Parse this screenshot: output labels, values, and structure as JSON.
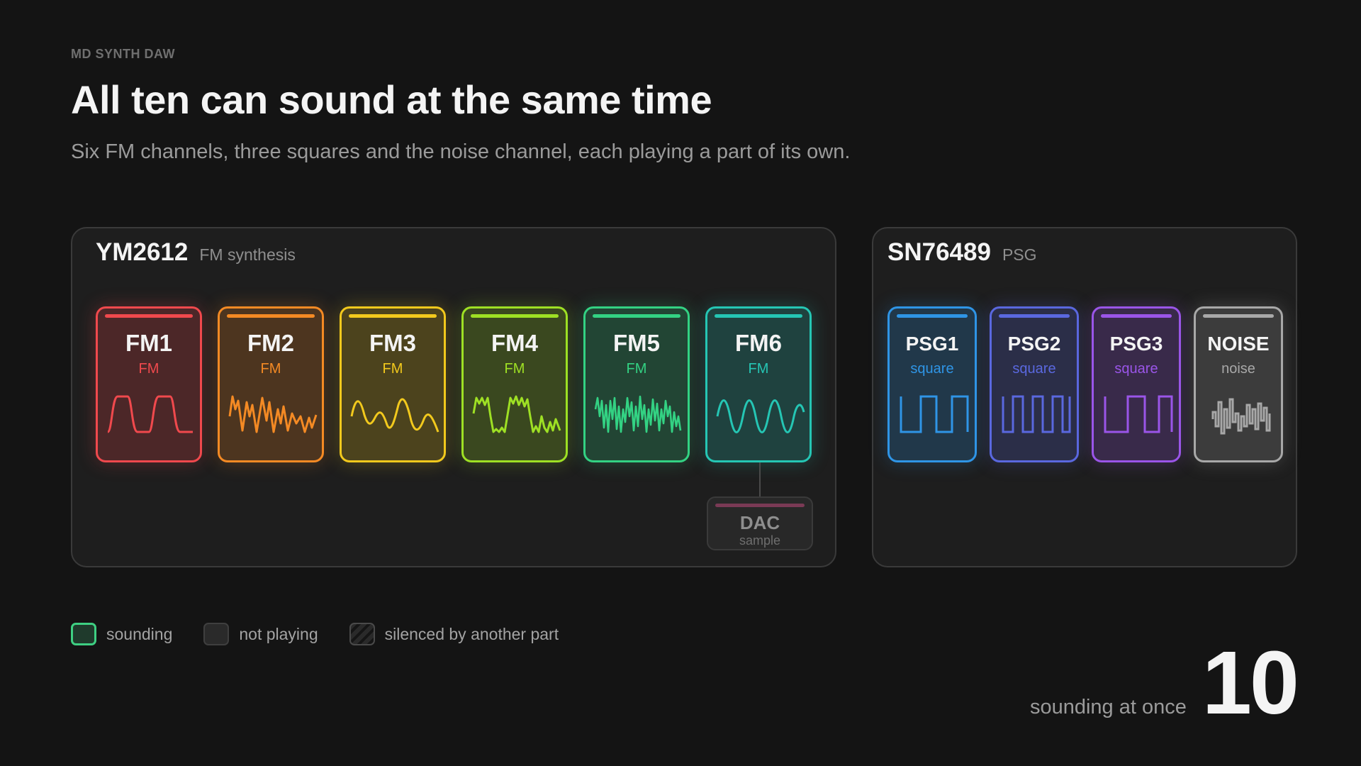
{
  "eyebrow": "MD SYNTH DAW",
  "title": "All ten can sound at the same time",
  "subtitle": "Six FM channels, three squares and the noise channel, each playing a part of its own.",
  "fm_chip": {
    "name": "YM2612",
    "kind": "FM synthesis",
    "channels": [
      {
        "name": "FM1",
        "type": "FM",
        "color": "#f0494d",
        "state": "sounding"
      },
      {
        "name": "FM2",
        "type": "FM",
        "color": "#f48a24",
        "state": "sounding"
      },
      {
        "name": "FM3",
        "type": "FM",
        "color": "#f2c91d",
        "state": "sounding"
      },
      {
        "name": "FM4",
        "type": "FM",
        "color": "#9ee024",
        "state": "sounding"
      },
      {
        "name": "FM5",
        "type": "FM",
        "color": "#33d283",
        "state": "sounding"
      },
      {
        "name": "FM6",
        "type": "FM",
        "color": "#25c6b4",
        "state": "sounding"
      }
    ],
    "dac": {
      "name": "DAC",
      "type": "sample",
      "color": "#7a3a55",
      "state": "not playing"
    }
  },
  "psg_chip": {
    "name": "SN76489",
    "kind": "PSG",
    "channels": [
      {
        "name": "PSG1",
        "type": "square",
        "color": "#2f95e6",
        "state": "sounding"
      },
      {
        "name": "PSG2",
        "type": "square",
        "color": "#5a68df",
        "state": "sounding"
      },
      {
        "name": "PSG3",
        "type": "square",
        "color": "#9a55e8",
        "state": "sounding"
      },
      {
        "name": "NOISE",
        "type": "noise",
        "color": "#a8a8a8",
        "state": "sounding"
      }
    ]
  },
  "legend": {
    "sounding": "sounding",
    "not_playing": "not playing",
    "silenced": "silenced by another part"
  },
  "counter": {
    "label": "sounding at once",
    "value": "10"
  },
  "icons": [
    "waveform-icon",
    "square-wave-icon",
    "noise-wave-icon"
  ]
}
